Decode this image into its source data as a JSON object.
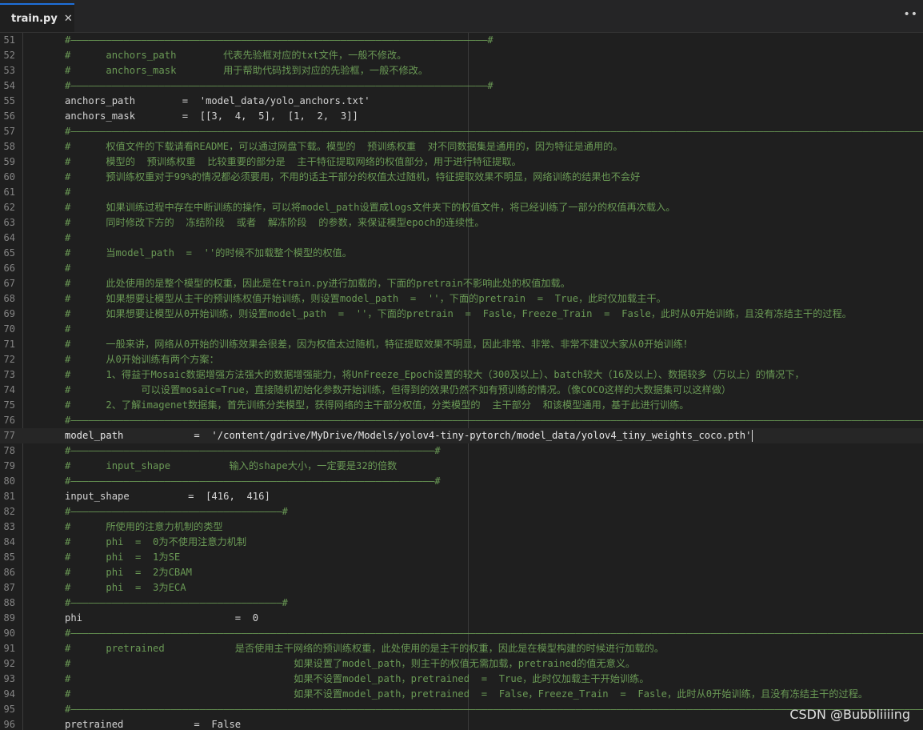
{
  "tab": {
    "title": "train.py",
    "close": "✕"
  },
  "more_menu": "••",
  "watermark": "CSDN @Bubbliiiing",
  "lines": [
    {
      "n": 51,
      "t": "#———————————————————————————————————————————————————————————————————————#",
      "c": true
    },
    {
      "n": 52,
      "t": "#      anchors_path        代表先验框对应的txt文件，一般不修改。",
      "c": true
    },
    {
      "n": 53,
      "t": "#      anchors_mask        用于帮助代码找到对应的先验框，一般不修改。",
      "c": true
    },
    {
      "n": 54,
      "t": "#———————————————————————————————————————————————————————————————————————#",
      "c": true
    },
    {
      "n": 55,
      "t": "anchors_path        =  'model_data/yolo_anchors.txt'",
      "c": false
    },
    {
      "n": 56,
      "t": "anchors_mask        =  [[3,  4,  5],  [1,  2,  3]]",
      "c": false
    },
    {
      "n": 57,
      "t": "#——————————————————————————————————————————————————————————————————————————————————————————————————————————————————————————————————————————————————————#",
      "c": true
    },
    {
      "n": 58,
      "t": "#      权值文件的下载请看README，可以通过网盘下载。模型的  预训练权重  对不同数据集是通用的，因为特征是通用的。",
      "c": true
    },
    {
      "n": 59,
      "t": "#      模型的  预训练权重  比较重要的部分是  主干特征提取网络的权值部分，用于进行特征提取。",
      "c": true
    },
    {
      "n": 60,
      "t": "#      预训练权重对于99%的情况都必须要用，不用的话主干部分的权值太过随机，特征提取效果不明显，网络训练的结果也不会好",
      "c": true
    },
    {
      "n": 61,
      "t": "#",
      "c": true
    },
    {
      "n": 62,
      "t": "#      如果训练过程中存在中断训练的操作，可以将model_path设置成logs文件夹下的权值文件，将已经训练了一部分的权值再次载入。",
      "c": true
    },
    {
      "n": 63,
      "t": "#      同时修改下方的  冻结阶段  或者  解冻阶段  的参数，来保证模型epoch的连续性。",
      "c": true
    },
    {
      "n": 64,
      "t": "#",
      "c": true
    },
    {
      "n": 65,
      "t": "#      当model_path  =  ''的时候不加载整个模型的权值。",
      "c": true
    },
    {
      "n": 66,
      "t": "#",
      "c": true
    },
    {
      "n": 67,
      "t": "#      此处使用的是整个模型的权重，因此是在train.py进行加载的，下面的pretrain不影响此处的权值加载。",
      "c": true
    },
    {
      "n": 68,
      "t": "#      如果想要让模型从主干的预训练权值开始训练，则设置model_path  =  ''，下面的pretrain  =  True，此时仅加载主干。",
      "c": true
    },
    {
      "n": 69,
      "t": "#      如果想要让模型从0开始训练，则设置model_path  =  ''，下面的pretrain  =  Fasle，Freeze_Train  =  Fasle，此时从0开始训练，且没有冻结主干的过程。",
      "c": true
    },
    {
      "n": 70,
      "t": "#",
      "c": true
    },
    {
      "n": 71,
      "t": "#      一般来讲，网络从0开始的训练效果会很差，因为权值太过随机，特征提取效果不明显，因此非常、非常、非常不建议大家从0开始训练！",
      "c": true
    },
    {
      "n": 72,
      "t": "#      从0开始训练有两个方案：",
      "c": true
    },
    {
      "n": 73,
      "t": "#      1、得益于Mosaic数据增强方法强大的数据增强能力，将UnFreeze_Epoch设置的较大（300及以上）、batch较大（16及以上）、数据较多（万以上）的情况下，",
      "c": true
    },
    {
      "n": 74,
      "t": "#            可以设置mosaic=True，直接随机初始化参数开始训练，但得到的效果仍然不如有预训练的情况。（像COCO这样的大数据集可以这样做）",
      "c": true
    },
    {
      "n": 75,
      "t": "#      2、了解imagenet数据集，首先训练分类模型，获得网络的主干部分权值，分类模型的  主干部分  和该模型通用，基于此进行训练。",
      "c": true
    },
    {
      "n": 76,
      "t": "#——————————————————————————————————————————————————————————————————————————————————————————————————————————————————————————————————————————————————————#",
      "c": true
    },
    {
      "n": 77,
      "t": "model_path            =  '/content/gdrive/MyDrive/Models/yolov4-tiny-pytorch/model_data/yolov4_tiny_weights_coco.pth'",
      "c": false,
      "cur": true
    },
    {
      "n": 78,
      "t": "#——————————————————————————————————————————————————————————————#",
      "c": true
    },
    {
      "n": 79,
      "t": "#      input_shape          输入的shape大小，一定要是32的倍数",
      "c": true
    },
    {
      "n": 80,
      "t": "#——————————————————————————————————————————————————————————————#",
      "c": true
    },
    {
      "n": 81,
      "t": "input_shape          =  [416,  416]",
      "c": false
    },
    {
      "n": 82,
      "t": "#————————————————————————————————————#",
      "c": true
    },
    {
      "n": 83,
      "t": "#      所使用的注意力机制的类型",
      "c": true
    },
    {
      "n": 84,
      "t": "#      phi  =  0为不使用注意力机制",
      "c": true
    },
    {
      "n": 85,
      "t": "#      phi  =  1为SE",
      "c": true
    },
    {
      "n": 86,
      "t": "#      phi  =  2为CBAM",
      "c": true
    },
    {
      "n": 87,
      "t": "#      phi  =  3为ECA",
      "c": true
    },
    {
      "n": 88,
      "t": "#————————————————————————————————————#",
      "c": true
    },
    {
      "n": 89,
      "t": "phi                          =  0",
      "c": false
    },
    {
      "n": 90,
      "t": "#——————————————————————————————————————————————————————————————————————————————————————————————————————————————————————————————————————————————————————#",
      "c": true
    },
    {
      "n": 91,
      "t": "#      pretrained            是否使用主干网络的预训练权重，此处使用的是主干的权重，因此是在模型构建的时候进行加载的。",
      "c": true
    },
    {
      "n": 92,
      "t": "#                                      如果设置了model_path，则主干的权值无需加载，pretrained的值无意义。",
      "c": true
    },
    {
      "n": 93,
      "t": "#                                      如果不设置model_path，pretrained  =  True，此时仅加载主干开始训练。",
      "c": true
    },
    {
      "n": 94,
      "t": "#                                      如果不设置model_path，pretrained  =  False，Freeze_Train  =  Fasle，此时从0开始训练，且没有冻结主干的过程。",
      "c": true
    },
    {
      "n": 95,
      "t": "#——————————————————————————————————————————————————————————————————————————————————————————————————————————————————————————————————————————————————————#",
      "c": true
    },
    {
      "n": 96,
      "t": "pretrained            =  False",
      "c": false
    }
  ]
}
